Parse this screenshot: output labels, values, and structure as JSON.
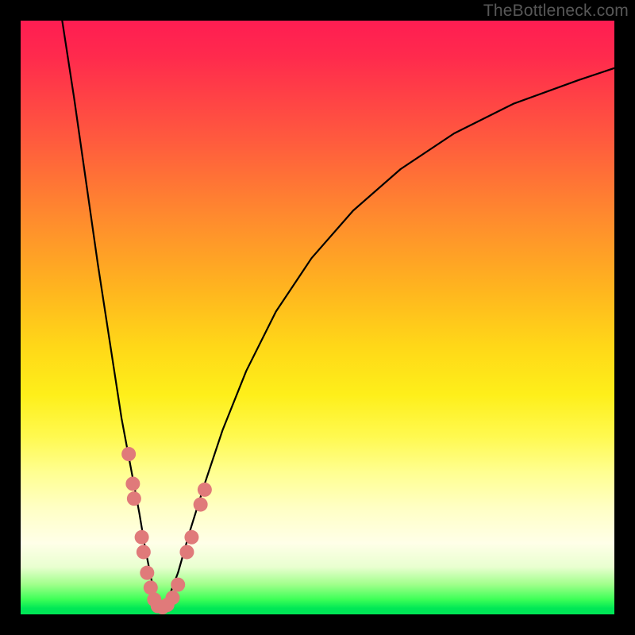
{
  "watermark": "TheBottleneck.com",
  "chart_data": {
    "type": "line",
    "title": "",
    "xlabel": "",
    "ylabel": "",
    "xlim": [
      0,
      100
    ],
    "ylim": [
      0,
      100
    ],
    "note": "Two black curves forming a V-shaped bottleneck trough near x≈23; salmon-colored marker dots cluster near the trough on both arms. Axes have no tick labels; values are normalized 0–100 estimates of position within the plot area.",
    "series": [
      {
        "name": "left-arm",
        "color": "#000000",
        "x": [
          7.0,
          9.0,
          11.0,
          13.0,
          15.0,
          17.0,
          18.5,
          20.0,
          21.0,
          22.0,
          22.8,
          23.3
        ],
        "y": [
          100,
          87,
          73,
          59,
          46,
          33,
          25,
          17,
          11,
          6,
          2.5,
          1.0
        ]
      },
      {
        "name": "right-arm",
        "color": "#000000",
        "x": [
          24.0,
          25.0,
          26.5,
          28.5,
          31.0,
          34.0,
          38.0,
          43.0,
          49.0,
          56.0,
          64.0,
          73.0,
          83.0,
          94.0,
          100.0
        ],
        "y": [
          1.0,
          3.0,
          7.0,
          14.0,
          22.0,
          31.0,
          41.0,
          51.0,
          60.0,
          68.0,
          75.0,
          81.0,
          86.0,
          90.0,
          92.0
        ]
      }
    ],
    "markers": {
      "name": "dots",
      "color": "#e07a7a",
      "radius_px": 9,
      "points": [
        {
          "x": 18.2,
          "y": 27.0
        },
        {
          "x": 18.9,
          "y": 22.0
        },
        {
          "x": 19.1,
          "y": 19.5
        },
        {
          "x": 20.4,
          "y": 13.0
        },
        {
          "x": 20.7,
          "y": 10.5
        },
        {
          "x": 21.3,
          "y": 7.0
        },
        {
          "x": 21.9,
          "y": 4.5
        },
        {
          "x": 22.5,
          "y": 2.5
        },
        {
          "x": 23.1,
          "y": 1.4
        },
        {
          "x": 23.9,
          "y": 1.2
        },
        {
          "x": 24.7,
          "y": 1.6
        },
        {
          "x": 25.6,
          "y": 2.8
        },
        {
          "x": 26.5,
          "y": 5.0
        },
        {
          "x": 28.0,
          "y": 10.5
        },
        {
          "x": 28.8,
          "y": 13.0
        },
        {
          "x": 30.3,
          "y": 18.5
        },
        {
          "x": 31.0,
          "y": 21.0
        }
      ]
    }
  }
}
